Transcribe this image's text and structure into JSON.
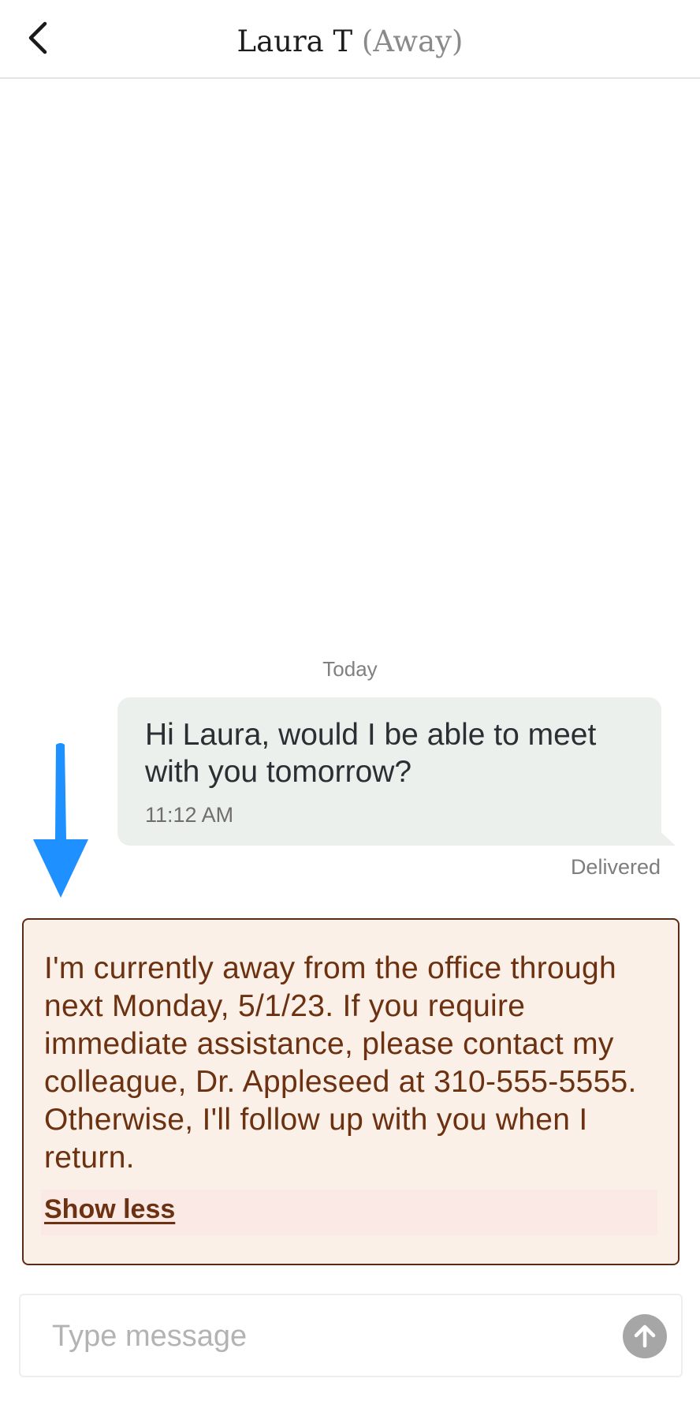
{
  "header": {
    "contact_name": "Laura T",
    "contact_status": "(Away)",
    "back_icon": "chevron-left-icon"
  },
  "conversation": {
    "date_divider": "Today",
    "messages": [
      {
        "direction": "outgoing",
        "text": "Hi Laura, would I be able to meet with you tomorrow?",
        "time": "11:12 AM",
        "status": "Delivered"
      }
    ],
    "auto_reply": {
      "text": "I'm currently away from the office through next Monday, 5/1/23. If you require immediate assistance, please contact my colleague, Dr. Appleseed at 310-555-5555. Otherwise, I'll follow up with you when I return.",
      "toggle_label": "Show less"
    }
  },
  "composer": {
    "placeholder": "Type message",
    "value": "",
    "send_icon": "arrow-up-icon"
  },
  "annotation": {
    "arrow_icon": "down-arrow-icon",
    "arrow_color": "#1e90ff"
  },
  "colors": {
    "outgoing_bubble": "#ebf0ec",
    "auto_reply_background": "#fbf0e8",
    "auto_reply_border": "#5a2b17",
    "auto_reply_text": "#6b3110",
    "send_button": "#a6a6a6"
  }
}
